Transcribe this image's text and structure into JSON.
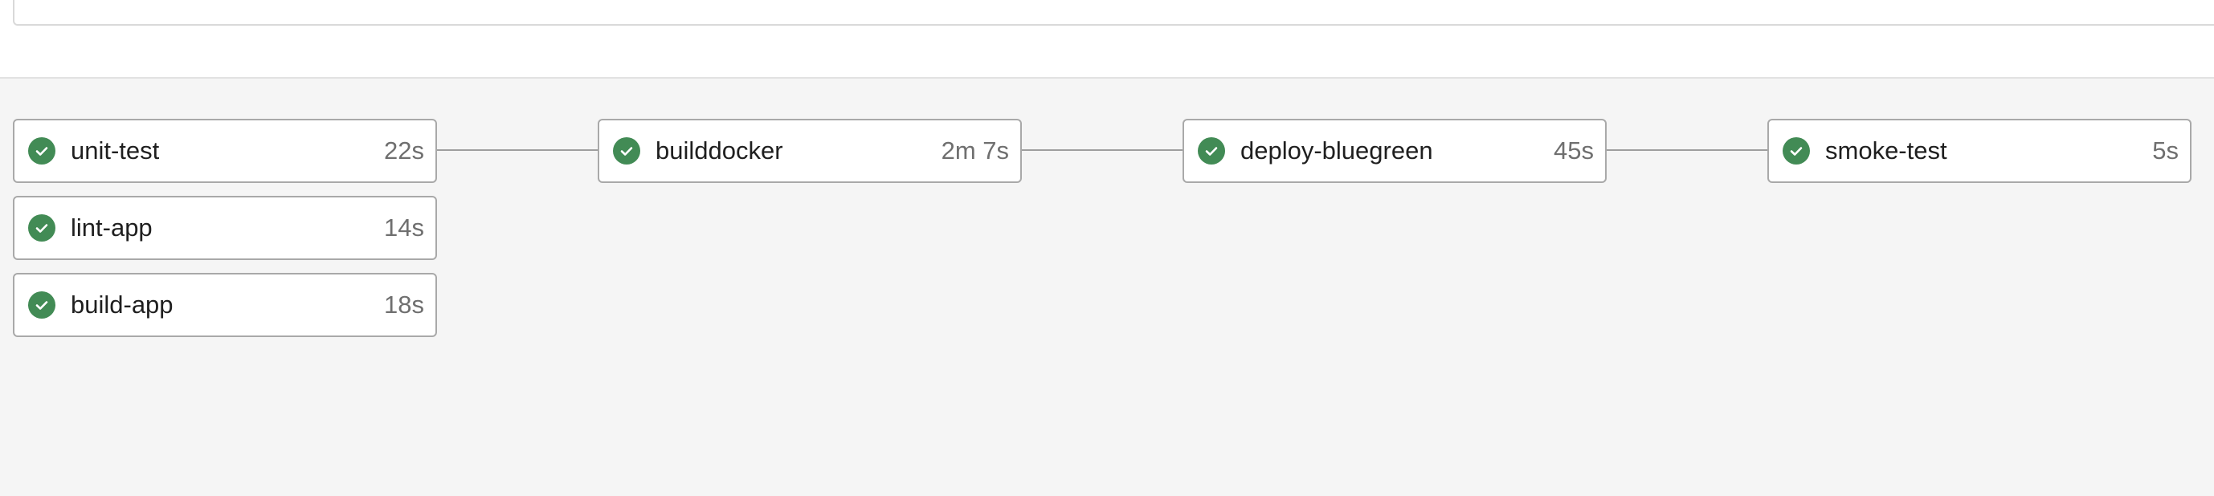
{
  "pipeline": {
    "stages": [
      {
        "jobs": [
          {
            "name": "unit-test",
            "duration": "22s",
            "status": "success"
          },
          {
            "name": "lint-app",
            "duration": "14s",
            "status": "success"
          },
          {
            "name": "build-app",
            "duration": "18s",
            "status": "success"
          }
        ]
      },
      {
        "jobs": [
          {
            "name": "builddocker",
            "duration": "2m 7s",
            "status": "success"
          }
        ]
      },
      {
        "jobs": [
          {
            "name": "deploy-bluegreen",
            "duration": "45s",
            "status": "success"
          }
        ]
      },
      {
        "jobs": [
          {
            "name": "smoke-test",
            "duration": "5s",
            "status": "success"
          }
        ]
      }
    ]
  },
  "colors": {
    "success": "#428b55",
    "background": "#f5f5f5"
  },
  "icons": {
    "status": "check-circle-icon"
  }
}
